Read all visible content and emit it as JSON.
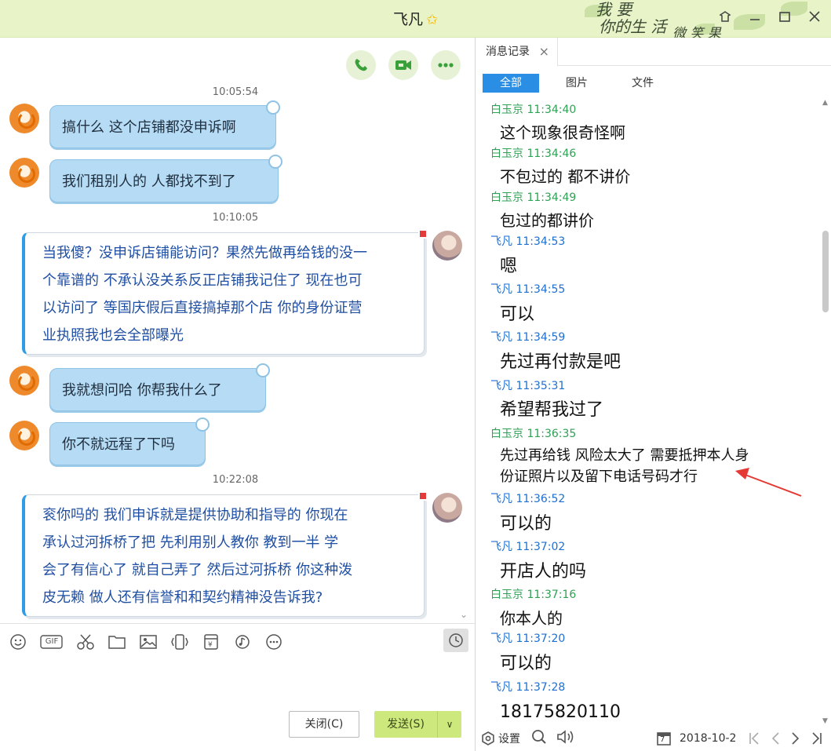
{
  "window": {
    "title": "飞凡",
    "art_text_1": "我 要",
    "art_text_2": "你的生 活",
    "art_text_3": "微 笑 果"
  },
  "chat": {
    "timestamps": [
      "10:05:54",
      "10:10:05",
      "10:22:08"
    ],
    "messages": [
      {
        "lines": [
          "搞什么  这个店铺都没申诉啊"
        ]
      },
      {
        "lines": [
          "我们租别人的  人都找不到了"
        ]
      },
      {
        "lines": [
          "当我傻？没申诉店铺能访问？果然先做再给钱的没一",
          "个靠谱的     不承认没关系反正店铺我记住了 现在也可",
          "以访问了  等国庆假后直接搞掉那个店  你的身份证营",
          "业执照我也会全部曝光"
        ]
      },
      {
        "lines": [
          "我就想问哈 你帮我什么了"
        ]
      },
      {
        "lines": [
          "你不就远程了下吗"
        ]
      },
      {
        "lines": [
          "衮你吗的  我们申诉就是提供协助和指导的     你现在",
          "承认过河拆桥了把      先利用别人教你  教到一半  学",
          "会了有信心了 就自己弄了  然后过河拆桥     你这种泼",
          "皮无赖 做人还有信誉和和契约精神没告诉我?"
        ]
      }
    ]
  },
  "toolbar": {
    "gif_label": "GIF",
    "close_label": "关闭(C)",
    "send_label": "发送(S)"
  },
  "history": {
    "tab_label": "消息记录",
    "filters": [
      "全部",
      "图片",
      "文件"
    ],
    "records": [
      {
        "name": "白玉京",
        "time": "11:34:40",
        "text": "这个现象很奇怪啊"
      },
      {
        "name": "白玉京",
        "time": "11:34:46",
        "text": "不包过的 都不讲价"
      },
      {
        "name": "白玉京",
        "time": "11:34:49",
        "text": "包过的都讲价"
      },
      {
        "name": "飞凡",
        "time": "11:34:53",
        "text": "嗯"
      },
      {
        "name": "飞凡",
        "time": "11:34:55",
        "text": "可以"
      },
      {
        "name": "飞凡",
        "time": "11:34:59",
        "text": "先过再付款是吧"
      },
      {
        "name": "飞凡",
        "time": "11:35:31",
        "text": "希望帮我过了"
      },
      {
        "name": "白玉京",
        "time": "11:36:35",
        "text": "先过再给钱 风险太大了     需要抵押本人身",
        "text2": "份证照片以及留下电话号码才行"
      },
      {
        "name": "飞凡",
        "time": "11:36:52",
        "text": "可以的"
      },
      {
        "name": "飞凡",
        "time": "11:37:02",
        "text": "开店人的吗"
      },
      {
        "name": "白玉京",
        "time": "11:37:16",
        "text": "你本人的"
      },
      {
        "name": "飞凡",
        "time": "11:37:20",
        "text": "可以的"
      },
      {
        "name": "飞凡",
        "time": "11:37:28",
        "text": "18175820110"
      }
    ],
    "settings_label": "设置",
    "date": "2018-10-2",
    "calendar_day": "7"
  },
  "colors": {
    "titlebar_bg": "#e8f4c8",
    "incoming_bubble": "#b6dcf5",
    "outgoing_text": "#1f4fa3",
    "name_bai": "#2ea154",
    "name_fei": "#1e6fd0",
    "filter_active": "#2a8fe4",
    "send_button": "#cde87d",
    "annotation_arrow": "#e53935"
  }
}
